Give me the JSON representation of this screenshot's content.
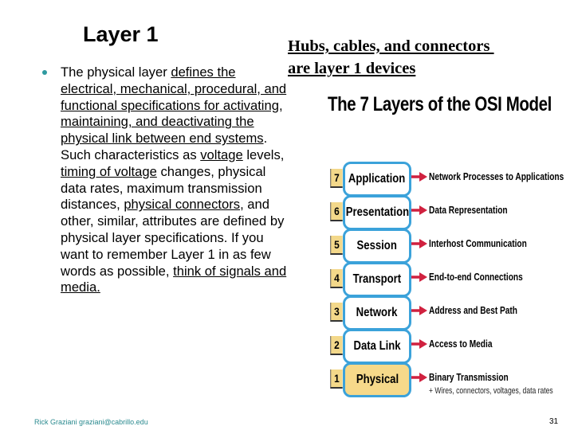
{
  "slide": {
    "title": "Layer 1",
    "body_segments": [
      {
        "text": "The physical layer ",
        "underline": false
      },
      {
        "text": "defines the electrical, mechanical, procedural, and functional specifications for activating, maintaining, and deactivating the physical link between end systems",
        "underline": true
      },
      {
        "text": ". Such characteristics as ",
        "underline": false
      },
      {
        "text": "voltage",
        "underline": true
      },
      {
        "text": " levels, ",
        "underline": false
      },
      {
        "text": "timing of voltage",
        "underline": true
      },
      {
        "text": " changes, physical data rates, maximum transmission distances, ",
        "underline": false
      },
      {
        "text": "physical connectors",
        "underline": true
      },
      {
        "text": ", and other, similar, attributes are defined by physical layer specifications. If you want to remember Layer 1 in as few words as possible, ",
        "underline": false
      },
      {
        "text": "think of signals and media.",
        "underline": true
      }
    ],
    "subtitle_line1": "Hubs, cables, and connectors ",
    "subtitle_line2": "are layer 1 devices",
    "bullet_color": "#2e9aa0"
  },
  "osi_model": {
    "title": "The 7 Layers of the OSI Model",
    "accent_border": "#3ba2da",
    "number_fill": "#f3d88a",
    "highlight_fill": "#f6d98a",
    "arrow_color": "#d0213f",
    "layers": [
      {
        "number": "7",
        "name": "Application",
        "description": "Network Processes to Applications",
        "highlight": false
      },
      {
        "number": "6",
        "name": "Presentation",
        "description": "Data Representation",
        "highlight": false
      },
      {
        "number": "5",
        "name": "Session",
        "description": "Interhost Communication",
        "highlight": false
      },
      {
        "number": "4",
        "name": "Transport",
        "description": "End-to-end Connections",
        "highlight": false
      },
      {
        "number": "3",
        "name": "Network",
        "description": "Address and Best Path",
        "highlight": false
      },
      {
        "number": "2",
        "name": "Data Link",
        "description": "Access to Media",
        "highlight": false
      },
      {
        "number": "1",
        "name": "Physical",
        "description": "Binary Transmission",
        "sub_description": "+ Wires, connectors, voltages, data rates",
        "highlight": true
      }
    ]
  },
  "footer": {
    "author": "Rick Graziani  graziani@cabrillo.edu",
    "page_number": "31",
    "author_color": "#2a8a8f"
  }
}
